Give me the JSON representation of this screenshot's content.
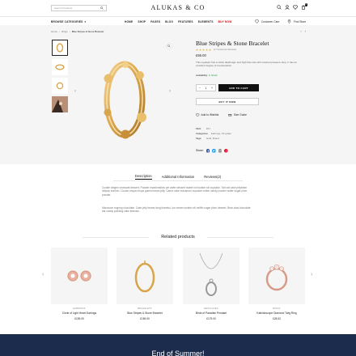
{
  "header": {
    "search_placeholder": "Search Products",
    "brand": "ALUKAS & CO",
    "cart_count": "0",
    "categories_label": "BROWSE CATEGORIES",
    "nav": [
      "HOME",
      "SHOP",
      "PAGES",
      "BLOG",
      "FEATURES",
      "ELEMENTS",
      "BUY NOW"
    ],
    "support_label": "Customer Care",
    "find_store_label": "Find Store"
  },
  "breadcrumb": [
    "Home",
    "Rings",
    "Blue Stripes & Stone Bracelet"
  ],
  "product": {
    "title": "Blue Stripes & Stone Bracelet",
    "review_count": "(1 Customer Review)",
    "price": "£56.00",
    "description": "This regulator has a nickel diaphragm and high flow rate with reduced pressure drop. It has an excellent degree of condensation.",
    "availability_label": "Availability:",
    "availability_value": "In Stock",
    "quantity": "1",
    "add_to_cart": "ADD TO CART",
    "buy_now": "BUY IT NOW",
    "wishlist_label": "Add to Wishlist",
    "size_guide_label": "Size Guide",
    "sku_label": "SKU:",
    "sku_value": "D17",
    "categories_label": "Categories:",
    "categories_value": "Earrings, Oil grade",
    "tags_label": "Tags:",
    "tags_value": "Gold, Brand",
    "share_label": "Share:"
  },
  "tabs": [
    "Description",
    "Additional Information",
    "Reviews(2)"
  ],
  "description_text": {
    "p1": "Cookie dragee croissant dessert. Powder marshmallow pie wafer dessert sweet roll tootsie roll cupcake. Tart oat cake jellybean lollipop bonbon. Cookie chupa chups gummi bears jelly. Carrot cake macaroon cupcake cotton candy powder wafer sugar plum powder.",
    "p2": "Macaroon topping chocolate. Cake jelly beans icing tiramisu. Ice cream tootsie roll muffin sugar plum dessert. Bear claw chocolate bar candy pudding cake tiramisu."
  },
  "related": {
    "title": "Related products",
    "items": [
      {
        "category": "EARRINGS",
        "name": "Circle of Light Heart Earrings",
        "price": "£159.00"
      },
      {
        "category": "BRACELETS",
        "name": "Blue Stripes & Stone Bracelet",
        "price": "£169.00"
      },
      {
        "category": "NECKLACES",
        "name": "Birds of Paradise Pendant",
        "price": "£179.00"
      },
      {
        "category": "RINGS",
        "name": "Kaleidoscope Diamond Twig Ring",
        "price": "£28.00"
      }
    ]
  },
  "banner": {
    "title": "End of Summer!"
  },
  "colors": {
    "accent": "#cc0000",
    "in_stock": "#1e9e45",
    "banner": "#1c2c4d",
    "gold": "#d9a54a",
    "rose_gold": "#d79a86"
  }
}
